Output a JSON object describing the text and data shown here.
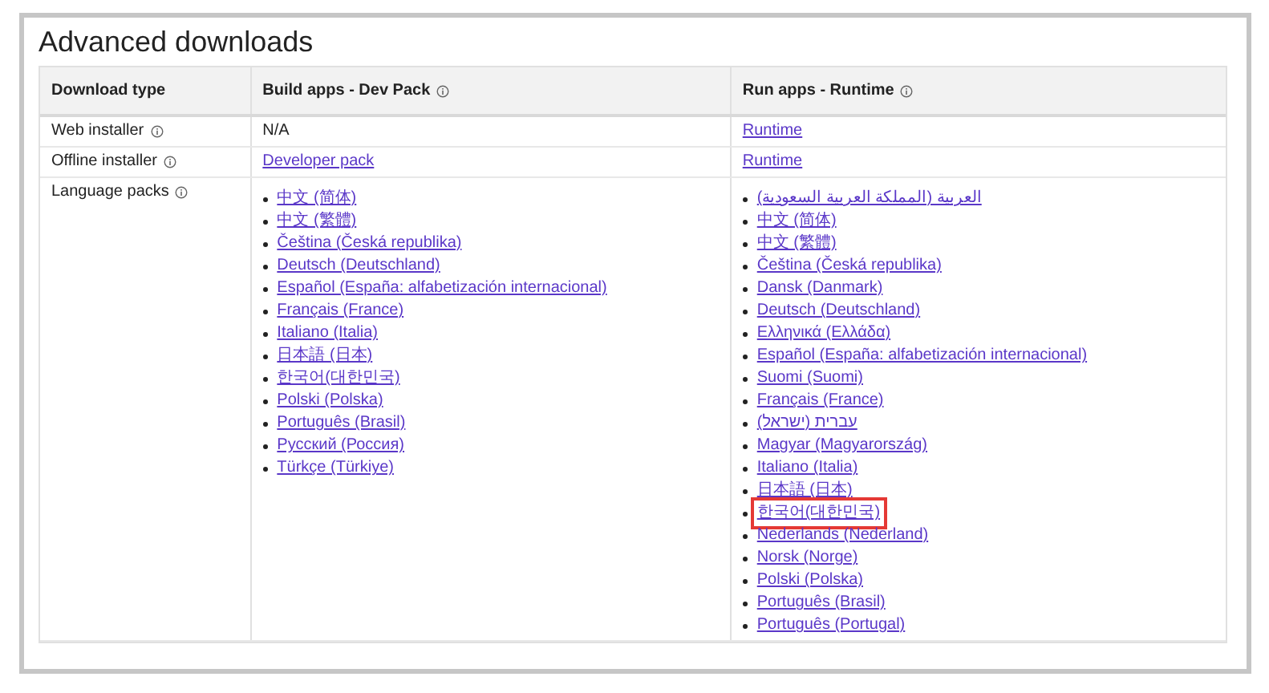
{
  "title": "Advanced downloads",
  "table": {
    "columns": [
      {
        "label": "Download type"
      },
      {
        "label": "Build apps - Dev Pack",
        "info": true
      },
      {
        "label": "Run apps - Runtime",
        "info": true
      }
    ],
    "rows": [
      {
        "cells": [
          {
            "kind": "label",
            "text": "Web installer",
            "info": true
          },
          {
            "kind": "text",
            "text": "N/A"
          },
          {
            "kind": "link",
            "text": "Runtime"
          }
        ]
      },
      {
        "cells": [
          {
            "kind": "label",
            "text": "Offline installer",
            "info": true
          },
          {
            "kind": "link",
            "text": "Developer pack"
          },
          {
            "kind": "link",
            "text": "Runtime"
          }
        ]
      },
      {
        "cells": [
          {
            "kind": "label",
            "text": "Language packs",
            "info": true
          },
          {
            "kind": "list",
            "items": [
              {
                "text": "中文 (简体)",
                "highlighted": false
              },
              {
                "text": "中文 (繁體)",
                "highlighted": false
              },
              {
                "text": "Čeština (Česká republika)",
                "highlighted": false
              },
              {
                "text": "Deutsch (Deutschland)",
                "highlighted": false
              },
              {
                "text": "Español (España: alfabetización internacional)",
                "highlighted": false
              },
              {
                "text": "Français (France)",
                "highlighted": false
              },
              {
                "text": "Italiano (Italia)",
                "highlighted": false
              },
              {
                "text": "日本語 (日本)",
                "highlighted": false
              },
              {
                "text": "한국어(대한민국)",
                "highlighted": false
              },
              {
                "text": "Polski (Polska)",
                "highlighted": false
              },
              {
                "text": "Português (Brasil)",
                "highlighted": false
              },
              {
                "text": "Русский (Россия)",
                "highlighted": false
              },
              {
                "text": "Türkçe (Türkiye)",
                "highlighted": false
              }
            ]
          },
          {
            "kind": "list",
            "items": [
              {
                "text": "العربية (المملكة العربية السعودية)",
                "highlighted": false
              },
              {
                "text": "中文 (简体)",
                "highlighted": false
              },
              {
                "text": "中文 (繁體)",
                "highlighted": false
              },
              {
                "text": "Čeština (Česká republika)",
                "highlighted": false
              },
              {
                "text": "Dansk (Danmark)",
                "highlighted": false
              },
              {
                "text": "Deutsch (Deutschland)",
                "highlighted": false
              },
              {
                "text": "Ελληνικά (Ελλάδα)",
                "highlighted": false
              },
              {
                "text": "Español (España: alfabetización internacional)",
                "highlighted": false
              },
              {
                "text": "Suomi (Suomi)",
                "highlighted": false
              },
              {
                "text": "Français (France)",
                "highlighted": false
              },
              {
                "text": "עברית (ישראל)",
                "highlighted": false
              },
              {
                "text": "Magyar (Magyarország)",
                "highlighted": false
              },
              {
                "text": "Italiano (Italia)",
                "highlighted": false
              },
              {
                "text": "日本語 (日本)",
                "highlighted": false
              },
              {
                "text": "한국어(대한민국)",
                "highlighted": true
              },
              {
                "text": "Nederlands (Nederland)",
                "highlighted": false
              },
              {
                "text": "Norsk (Norge)",
                "highlighted": false
              },
              {
                "text": "Polski (Polska)",
                "highlighted": false
              },
              {
                "text": "Português (Brasil)",
                "highlighted": false
              },
              {
                "text": "Português (Portugal)",
                "highlighted": false
              }
            ]
          }
        ]
      }
    ]
  }
}
